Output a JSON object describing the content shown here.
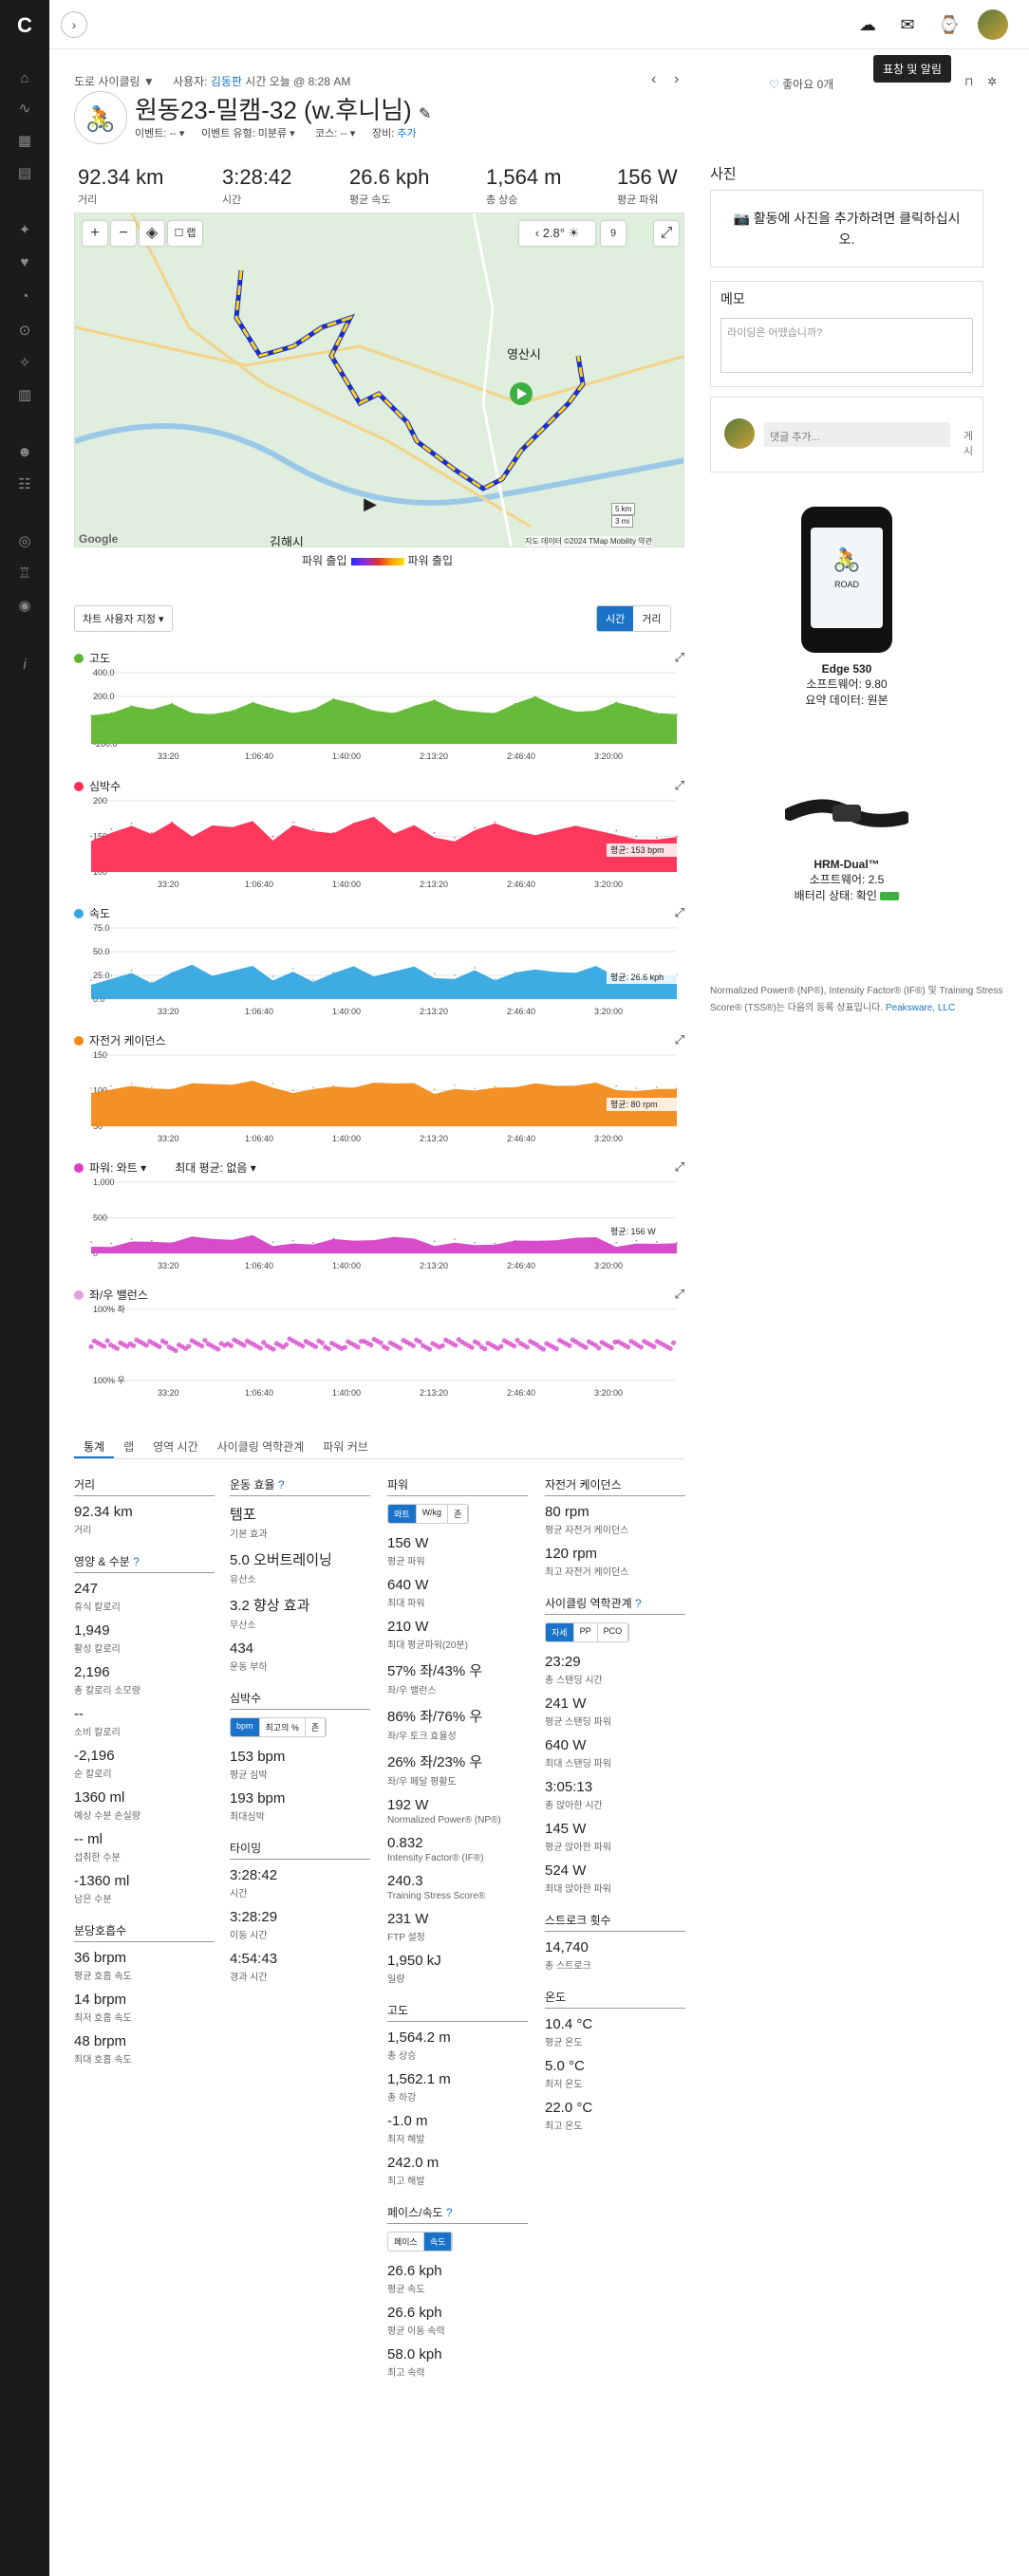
{
  "topbar": {
    "tooltip": "표창 및 알림"
  },
  "header": {
    "activity_type": "도로 사이클링 ▼",
    "user_label": "사용자:",
    "user_name": "김동판",
    "time_text": "시간 오늘 @ 8:28 AM",
    "likes": "좋아요 0개",
    "title": "원동23-밀캠-32 (w.후니님)",
    "event_label": "이벤트: -- ▾",
    "event_type_label": "이벤트 유형: 미분류 ▾",
    "course_label": "코스: -- ▾",
    "gear_label": "장비:",
    "gear_add": "추가"
  },
  "summary": [
    {
      "value": "92.34 km",
      "label": "거리"
    },
    {
      "value": "3:28:42",
      "label": "시간"
    },
    {
      "value": "26.6 kph",
      "label": "평균 속도"
    },
    {
      "value": "1,564 m",
      "label": "총 상승"
    },
    {
      "value": "156 W",
      "label": "평균 파워"
    }
  ],
  "map": {
    "temp": "2.8°",
    "wind": "9",
    "places": [
      "영산시",
      "김해시"
    ],
    "scale_km": "5 km",
    "scale_mi": "3 mi",
    "attribution": "지도 데이터 ©2024 TMap Mobility   약관",
    "google": "Google",
    "legend_low": "파워 출입",
    "legend_high": "파워 출입",
    "colors": {
      "route_low": "#2a2aff",
      "route_high": "#ffe600"
    }
  },
  "chart_controls": {
    "axis_select": "차트 사용자 지정 ▾",
    "time": "시간",
    "distance": "거리"
  },
  "charts": [
    {
      "title": "고도",
      "color": "#5fb72f",
      "yticks": [
        "400.0",
        "200.0",
        "0.0",
        "-200.0"
      ],
      "avg": ""
    },
    {
      "title": "심박수",
      "color": "#ff2d55",
      "yticks": [
        "200",
        "150",
        "100"
      ],
      "avg": "평균: 153 bpm"
    },
    {
      "title": "속도",
      "color": "#34a6e0",
      "yticks": [
        "75.0",
        "50.0",
        "25.0",
        "0.0"
      ],
      "avg": "평균: 26.6 kph"
    },
    {
      "title": "자전거 케이던스",
      "color": "#f28a1a",
      "yticks": [
        "150",
        "100",
        "50"
      ],
      "avg": "평균: 80 rpm"
    },
    {
      "title": "파워: 와트 ▾",
      "color": "#d641c8",
      "yticks": [
        "1,000",
        "500",
        "0"
      ],
      "avg": "평균: 156 W",
      "extra": "최대 평균: 없음 ▾"
    },
    {
      "title": "좌/우 밸런스",
      "color": "#e6a0dd",
      "yticks": [
        "100% 좌",
        "100% 우"
      ],
      "avg": ""
    }
  ],
  "chart_data": {
    "type": "area",
    "x_ticks": [
      "33:20",
      "1:06:40",
      "1:40:00",
      "2:13:20",
      "2:46:40",
      "3:20:00"
    ],
    "xlabel": "시간",
    "series": [
      {
        "name": "고도",
        "ylim": [
          -200,
          400
        ],
        "values": [
          40,
          60,
          120,
          90,
          140,
          60,
          50,
          80,
          150,
          100,
          60,
          90,
          180,
          140,
          80,
          60,
          120,
          170,
          90,
          70,
          60,
          140,
          200,
          120,
          70,
          80,
          150,
          110,
          60,
          50
        ]
      },
      {
        "name": "심박수",
        "ylim": [
          100,
          200
        ],
        "values": [
          150,
          160,
          168,
          155,
          170,
          148,
          162,
          158,
          165,
          150,
          170,
          160,
          155,
          168,
          175,
          150,
          160,
          155,
          148,
          162,
          170,
          158,
          150,
          155,
          160,
          152,
          158,
          150,
          148,
          150
        ]
      },
      {
        "name": "속도",
        "ylim": [
          0,
          75
        ],
        "values": [
          20,
          25,
          30,
          18,
          28,
          35,
          22,
          26,
          30,
          24,
          32,
          20,
          28,
          34,
          22,
          26,
          30,
          27,
          25,
          33,
          21,
          28,
          30,
          26,
          24,
          30,
          28,
          25,
          27,
          26
        ]
      },
      {
        "name": "자전거 케이던스",
        "ylim": [
          0,
          150
        ],
        "values": [
          80,
          85,
          90,
          82,
          78,
          88,
          84,
          80,
          86,
          90,
          76,
          82,
          85,
          80,
          88,
          84,
          82,
          78,
          86,
          80,
          84,
          82,
          88,
          80,
          78,
          82,
          85,
          80,
          82,
          80
        ]
      },
      {
        "name": "파워: 와트",
        "ylim": [
          0,
          1000
        ],
        "values": [
          160,
          140,
          200,
          180,
          150,
          220,
          170,
          140,
          190,
          160,
          180,
          150,
          210,
          170,
          160,
          190,
          150,
          170,
          200,
          150,
          140,
          180,
          160,
          150,
          170,
          160,
          150,
          180,
          160,
          150
        ]
      },
      {
        "name": "좌/우 밸런스",
        "ylim": [
          -100,
          100
        ],
        "values": [
          5,
          -3,
          8,
          2,
          -6,
          4,
          -2,
          6,
          1,
          -4,
          7,
          3,
          -5,
          2,
          6,
          -1,
          4,
          -3,
          5,
          2,
          -4,
          6,
          1,
          -2,
          5,
          3,
          -1,
          4,
          2,
          0
        ]
      }
    ]
  },
  "tabs": [
    "통계",
    "랩",
    "영역 시간",
    "사이클링 역학관계",
    "파워 커브"
  ],
  "stats": {
    "c1": {
      "distance_title": "거리",
      "distance_v": "92.34 km",
      "distance_l": "거리",
      "nutri_title": "영양 & 수분",
      "items": [
        [
          "247",
          "휴식 칼로리"
        ],
        [
          "1,949",
          "활성 칼로리"
        ],
        [
          "2,196",
          "총 칼로리 소모량"
        ],
        [
          "--",
          "소비 칼로리"
        ],
        [
          "-2,196",
          "순 칼로리"
        ],
        [
          "1360 ml",
          "예상 수분 손실량"
        ],
        [
          "-- ml",
          "섭취한 수분"
        ],
        [
          "-1360 ml",
          "남은 수분"
        ]
      ],
      "resp_title": "분당호흡수",
      "resp": [
        [
          "36 brpm",
          "평균 호흡 속도"
        ],
        [
          "14 brpm",
          "최저 호흡 속도"
        ],
        [
          "48 brpm",
          "최대 호흡 속도"
        ]
      ]
    },
    "c2": {
      "te_title": "운동 효율",
      "te": [
        [
          "템포",
          "기본 효과"
        ],
        [
          "5.0 오버트레이닝",
          "유산소"
        ],
        [
          "3.2 향상 효과",
          "무산소"
        ],
        [
          "434",
          "운동 부하"
        ]
      ],
      "hr_title": "심박수",
      "hr_seg": [
        "bpm",
        "최고의 %",
        "존"
      ],
      "hr": [
        [
          "153 bpm",
          "평균 심박"
        ],
        [
          "193 bpm",
          "최대심박"
        ]
      ],
      "time_title": "타이밍",
      "time": [
        [
          "3:28:42",
          "시간"
        ],
        [
          "3:28:29",
          "이동 시간"
        ],
        [
          "4:54:43",
          "경과 시간"
        ]
      ]
    },
    "c3": {
      "pw_title": "파워",
      "pw_seg": [
        "와트",
        "W/kg",
        "존"
      ],
      "pw": [
        [
          "156 W",
          "평균 파워"
        ],
        [
          "640 W",
          "최대 파워"
        ],
        [
          "210 W",
          "최대 평균파워(20분)"
        ],
        [
          "57% 좌/43% 우",
          "좌/우 밸런스"
        ],
        [
          "86% 좌/76% 우",
          "좌/우 토크 효율성"
        ],
        [
          "26% 좌/23% 우",
          "좌/우 페달 평활도"
        ],
        [
          "192 W",
          "Normalized Power® (NP®)"
        ],
        [
          "0.832",
          "Intensity Factor® (IF®)"
        ],
        [
          "240.3",
          "Training Stress Score®"
        ],
        [
          "231 W",
          "FTP 설정"
        ],
        [
          "1,950 kJ",
          "일량"
        ]
      ],
      "el_title": "고도",
      "el": [
        [
          "1,564.2 m",
          "총 상승"
        ],
        [
          "1,562.1 m",
          "총 하강"
        ],
        [
          "-1.0 m",
          "최저 해발"
        ],
        [
          "242.0 m",
          "최고 해발"
        ]
      ],
      "sp_title": "페이스/속도",
      "sp_seg": [
        "페이스",
        "속도"
      ],
      "sp": [
        [
          "26.6 kph",
          "평균 속도"
        ],
        [
          "26.6 kph",
          "평균 이동 속력"
        ],
        [
          "58.0 kph",
          "최고 속력"
        ]
      ]
    },
    "c4": {
      "cad_title": "자전거 케이던스",
      "cad": [
        [
          "80 rpm",
          "평균 자전거 케이던스"
        ],
        [
          "120 rpm",
          "최고 자전거 케이던스"
        ]
      ],
      "dyn_title": "사이클링 역학관계",
      "dyn_seg": [
        "자세",
        "PP",
        "PCO"
      ],
      "dyn": [
        [
          "23:29",
          "총 스탠딩 시간"
        ],
        [
          "241 W",
          "평균 스탠딩 파워"
        ],
        [
          "640 W",
          "최대 스탠딩 파워"
        ],
        [
          "3:05:13",
          "총 앉아한 시간"
        ],
        [
          "145 W",
          "평균 앉아한 파워"
        ],
        [
          "524 W",
          "최대 앉아한 파워"
        ]
      ],
      "str_title": "스트로크 횟수",
      "str": [
        [
          "14,740",
          "총 스트로크"
        ]
      ],
      "tmp_title": "온도",
      "tmp": [
        [
          "10.4 °C",
          "평균 온도"
        ],
        [
          "5.0 °C",
          "최저 온도"
        ],
        [
          "22.0 °C",
          "최고 온도"
        ]
      ]
    }
  },
  "right": {
    "photo_title": "사진",
    "photo_add": "활동에 사진을 추가하려면 클릭하십시오.",
    "memo_title": "메모",
    "memo_placeholder": "라이딩은 어땠습니까?",
    "comment_placeholder": "댓글 추가...",
    "comment_post": "게시",
    "device1_name": "Edge 530",
    "device1_sw": "소프트웨어: 9.80",
    "device1_src": "요약 데이터: 원본",
    "device1_screen": "ROAD",
    "device2_name": "HRM-Dual™",
    "device2_sw": "소프트웨어: 2.5",
    "device2_bat": "배터리 상태: 확인",
    "note": "Normalized Power® (NP®), Intensity Factor® (IF®) 및 Training Stress Score® (TSS®)는 다음의 등록 상표입니다. ",
    "note_link": "Peaksware, LLC"
  }
}
